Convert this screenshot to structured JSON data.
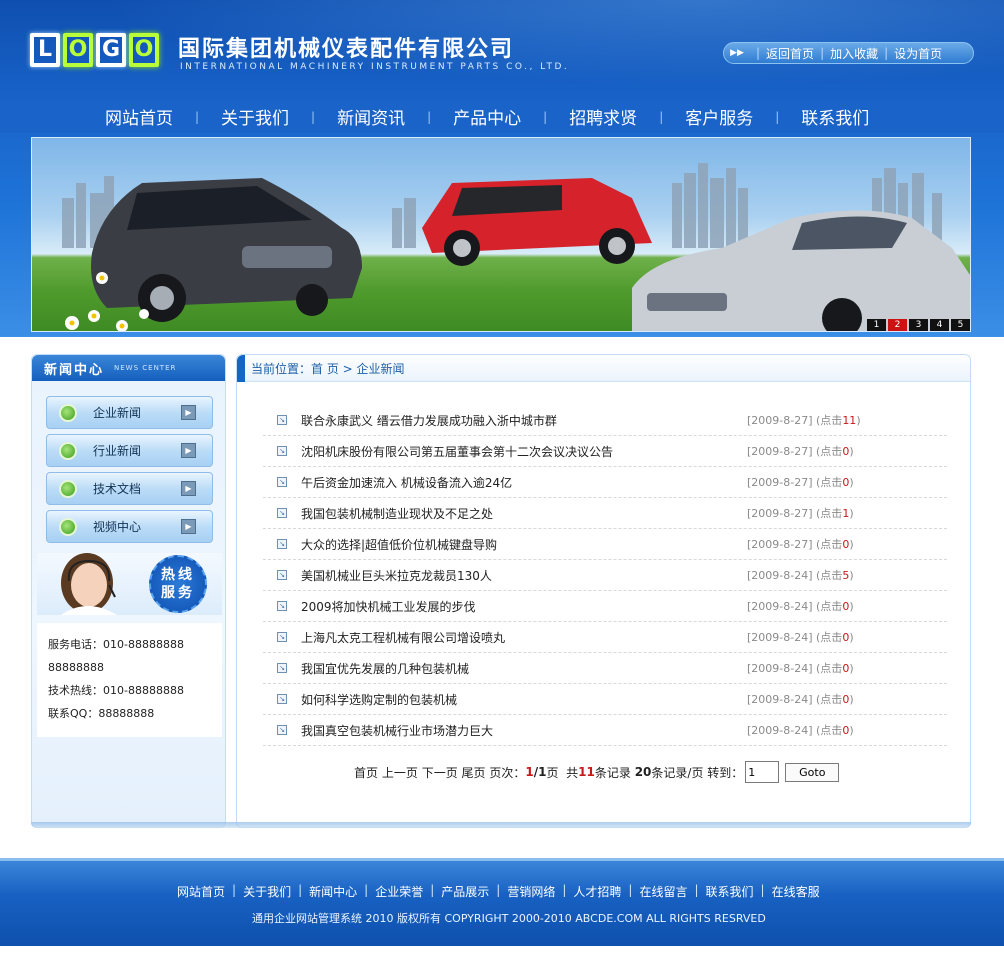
{
  "header": {
    "logo": [
      "L",
      "O",
      "G",
      "O"
    ],
    "company_cn": "国际集团机械仪表配件有限公司",
    "company_en": "INTERNATIONAL MACHINERY INSTRUMENT PARTS CO., LTD.",
    "toplinks": [
      "返回首页",
      "加入收藏",
      "设为首页"
    ]
  },
  "nav": [
    "网站首页",
    "关于我们",
    "新闻资讯",
    "产品中心",
    "招聘求贤",
    "客户服务",
    "联系我们"
  ],
  "banner": {
    "pager": [
      "1",
      "2",
      "3",
      "4",
      "5"
    ],
    "active_page": "2"
  },
  "sidebar": {
    "title_cn": "新闻中心",
    "title_en": "NEWS CENTER",
    "menu": [
      "企业新闻",
      "行业新闻",
      "技术文档",
      "视频中心"
    ],
    "hotline_badge": [
      "热线",
      "服务"
    ],
    "contact": [
      "服务电话：010-88888888",
      "88888888",
      "技术热线：010-88888888",
      "联系QQ：88888888"
    ]
  },
  "main": {
    "breadcrumb": "当前位置：首 页 > 企业新闻",
    "news": [
      {
        "title": "联合永康武义 缙云借力发展成功融入浙中城市群",
        "date": "[2009-8-27]",
        "hits_prefix": "(点击",
        "hits": "11",
        "hits_suffix": ")"
      },
      {
        "title": "沈阳机床股份有限公司第五届董事会第十二次会议决议公告",
        "date": "[2009-8-27]",
        "hits_prefix": "(点击",
        "hits": "0",
        "hits_suffix": ")"
      },
      {
        "title": "午后资金加速流入 机械设备流入逾24亿",
        "date": "[2009-8-27]",
        "hits_prefix": "(点击",
        "hits": "0",
        "hits_suffix": ")"
      },
      {
        "title": "我国包装机械制造业现状及不足之处",
        "date": "[2009-8-27]",
        "hits_prefix": "(点击",
        "hits": "1",
        "hits_suffix": ")"
      },
      {
        "title": "大众的选择|超值低价位机械键盘导购",
        "date": "[2009-8-27]",
        "hits_prefix": "(点击",
        "hits": "0",
        "hits_suffix": ")"
      },
      {
        "title": "美国机械业巨头米拉克龙裁员130人",
        "date": "[2009-8-24]",
        "hits_prefix": "(点击",
        "hits": "5",
        "hits_suffix": ")"
      },
      {
        "title": "2009将加快机械工业发展的步伐",
        "date": "[2009-8-24]",
        "hits_prefix": "(点击",
        "hits": "0",
        "hits_suffix": ")"
      },
      {
        "title": "上海凡太克工程机械有限公司增设喷丸",
        "date": "[2009-8-24]",
        "hits_prefix": "(点击",
        "hits": "0",
        "hits_suffix": ")"
      },
      {
        "title": "我国宜优先发展的几种包装机械",
        "date": "[2009-8-24]",
        "hits_prefix": "(点击",
        "hits": "0",
        "hits_suffix": ")"
      },
      {
        "title": "如何科学选购定制的包装机械",
        "date": "[2009-8-24]",
        "hits_prefix": "(点击",
        "hits": "0",
        "hits_suffix": ")"
      },
      {
        "title": "我国真空包装机械行业市场潜力巨大",
        "date": "[2009-8-24]",
        "hits_prefix": "(点击",
        "hits": "0",
        "hits_suffix": ")"
      }
    ],
    "pagination": {
      "first": "首页",
      "prev": "上一页",
      "next": "下一页",
      "last": "尾页",
      "pages_label": "页次：",
      "current": "1",
      "slash_total": "/1",
      "page_unit": "页",
      "total_prefix": "共",
      "total": "11",
      "total_suffix": "条记录",
      "per_page": "20",
      "per_page_suffix": "条记录/页",
      "goto_label": "转到：",
      "goto_value": "1",
      "goto_button": "Goto"
    }
  },
  "footer": {
    "links": [
      "网站首页",
      "关于我们",
      "新闻中心",
      "企业荣誉",
      "产品展示",
      "营销网络",
      "人才招聘",
      "在线留言",
      "联系我们",
      "在线客服"
    ],
    "copyright": "通用企业网站管理系统 2010 版权所有 COPYRIGHT 2000-2010 ABCDE.COM ALL RIGHTS RESRVED"
  }
}
